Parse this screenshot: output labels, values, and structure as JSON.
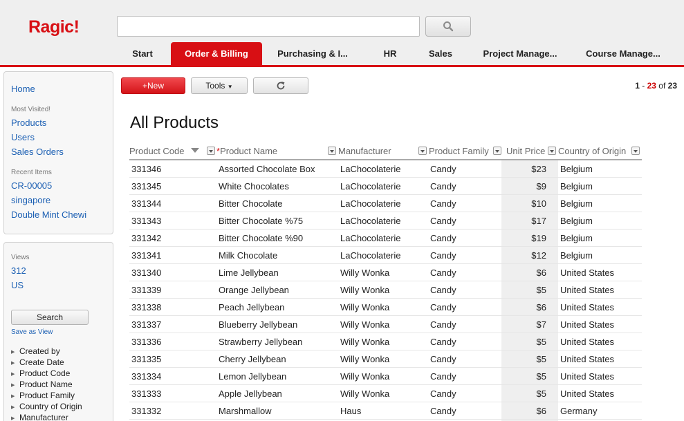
{
  "app": {
    "logo": "Ragic!"
  },
  "header": {
    "search_value": "",
    "tabs": [
      "Start",
      "Order & Billing",
      "Purchasing & I...",
      "HR",
      "Sales",
      "Project Manage...",
      "Course Manage..."
    ]
  },
  "sidebar": {
    "home": "Home",
    "most_visited_label": "Most Visited!",
    "most_visited": [
      "Products",
      "Users",
      "Sales Orders"
    ],
    "recent_label": "Recent Items",
    "recent": [
      "CR-00005",
      "singapore",
      "Double Mint Chewi"
    ],
    "views_label": "Views",
    "views": [
      "312",
      "US"
    ],
    "search_button": "Search",
    "save_as_view": "Save as View",
    "fields": [
      "Created by",
      "Create Date",
      "Product Code",
      "Product Name",
      "Product Family",
      "Country of Origin",
      "Manufacturer"
    ]
  },
  "toolbar": {
    "new_label": "+New",
    "tools_label": "Tools",
    "pager": {
      "from": "1",
      "to": "23",
      "of": "of",
      "total": "23"
    }
  },
  "page_title": "All Products",
  "table": {
    "columns": [
      "Product Code",
      "Product Name",
      "Manufacturer",
      "Product Family",
      "Unit Price",
      "Country of Origin"
    ],
    "required_mark": "*",
    "rows": [
      [
        "331346",
        "Assorted Chocolate Box",
        "LaChocolaterie",
        "Candy",
        "$23",
        "Belgium"
      ],
      [
        "331345",
        "White Chocolates",
        "LaChocolaterie",
        "Candy",
        "$9",
        "Belgium"
      ],
      [
        "331344",
        "Bitter Chocolate",
        "LaChocolaterie",
        "Candy",
        "$10",
        "Belgium"
      ],
      [
        "331343",
        "Bitter Chocolate %75",
        "LaChocolaterie",
        "Candy",
        "$17",
        "Belgium"
      ],
      [
        "331342",
        "Bitter Chocolate %90",
        "LaChocolaterie",
        "Candy",
        "$19",
        "Belgium"
      ],
      [
        "331341",
        "Milk Chocolate",
        "LaChocolaterie",
        "Candy",
        "$12",
        "Belgium"
      ],
      [
        "331340",
        "Lime Jellybean",
        "Willy Wonka",
        "Candy",
        "$6",
        "United States"
      ],
      [
        "331339",
        "Orange Jellybean",
        "Willy Wonka",
        "Candy",
        "$5",
        "United States"
      ],
      [
        "331338",
        "Peach Jellybean",
        "Willy Wonka",
        "Candy",
        "$6",
        "United States"
      ],
      [
        "331337",
        "Blueberry Jellybean",
        "Willy Wonka",
        "Candy",
        "$7",
        "United States"
      ],
      [
        "331336",
        "Strawberry Jellybean",
        "Willy Wonka",
        "Candy",
        "$5",
        "United States"
      ],
      [
        "331335",
        "Cherry Jellybean",
        "Willy Wonka",
        "Candy",
        "$5",
        "United States"
      ],
      [
        "331334",
        "Lemon Jellybean",
        "Willy Wonka",
        "Candy",
        "$5",
        "United States"
      ],
      [
        "331333",
        "Apple Jellybean",
        "Willy Wonka",
        "Candy",
        "$5",
        "United States"
      ],
      [
        "331332",
        "Marshmallow",
        "Haus",
        "Candy",
        "$6",
        "Germany"
      ]
    ]
  },
  "colors": {
    "brand_red": "#d80f14",
    "link_blue": "#1b5fb3"
  }
}
